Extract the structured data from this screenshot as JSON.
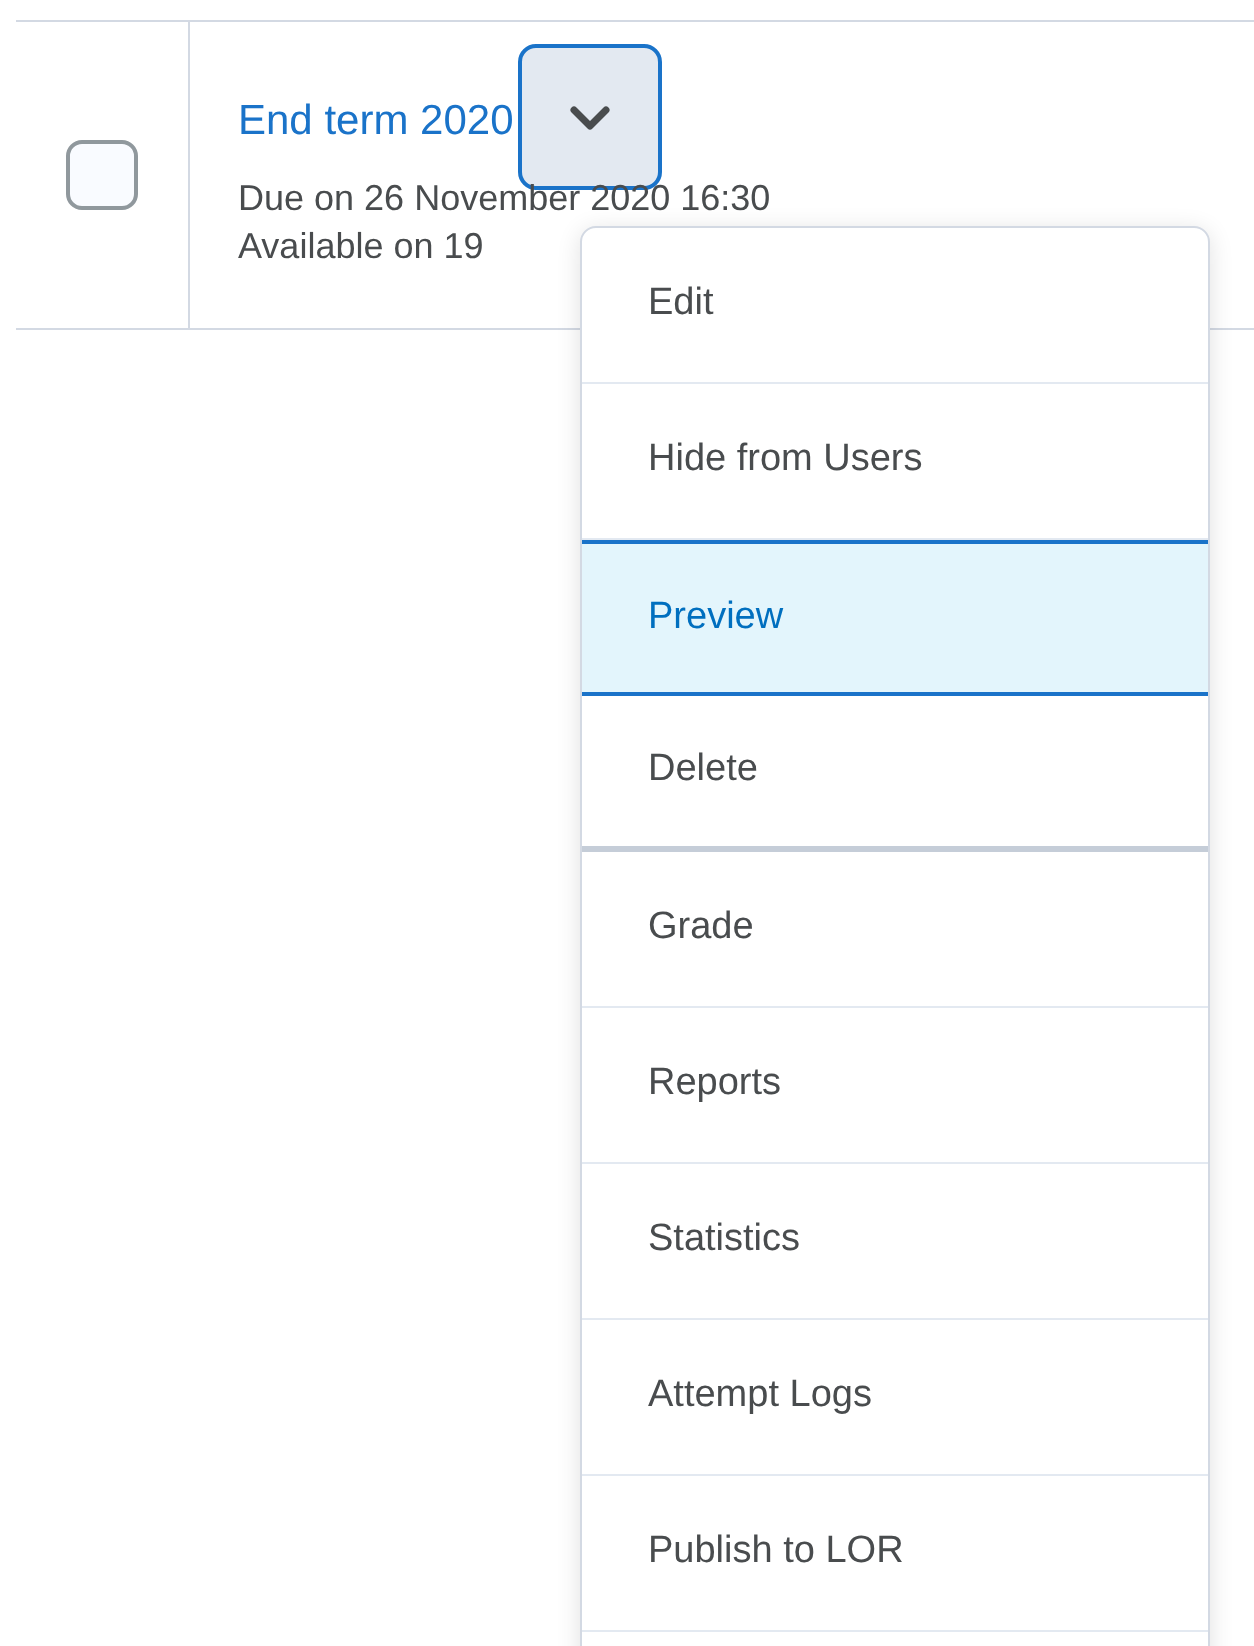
{
  "row": {
    "checked": false,
    "title": "End term 2020",
    "lines": [
      "Due on 26 November 2020 16:30",
      "Available on 19"
    ]
  },
  "menu_button": {
    "expanded": true
  },
  "menu": {
    "groups": [
      [
        {
          "label": "Edit",
          "selected": false
        },
        {
          "label": "Hide from Users",
          "selected": false
        },
        {
          "label": "Preview",
          "selected": true
        },
        {
          "label": "Delete",
          "selected": false
        }
      ],
      [
        {
          "label": "Grade",
          "selected": false
        },
        {
          "label": "Reports",
          "selected": false
        },
        {
          "label": "Statistics",
          "selected": false
        },
        {
          "label": "Attempt Logs",
          "selected": false
        },
        {
          "label": "Publish to LOR",
          "selected": false
        }
      ]
    ]
  }
}
